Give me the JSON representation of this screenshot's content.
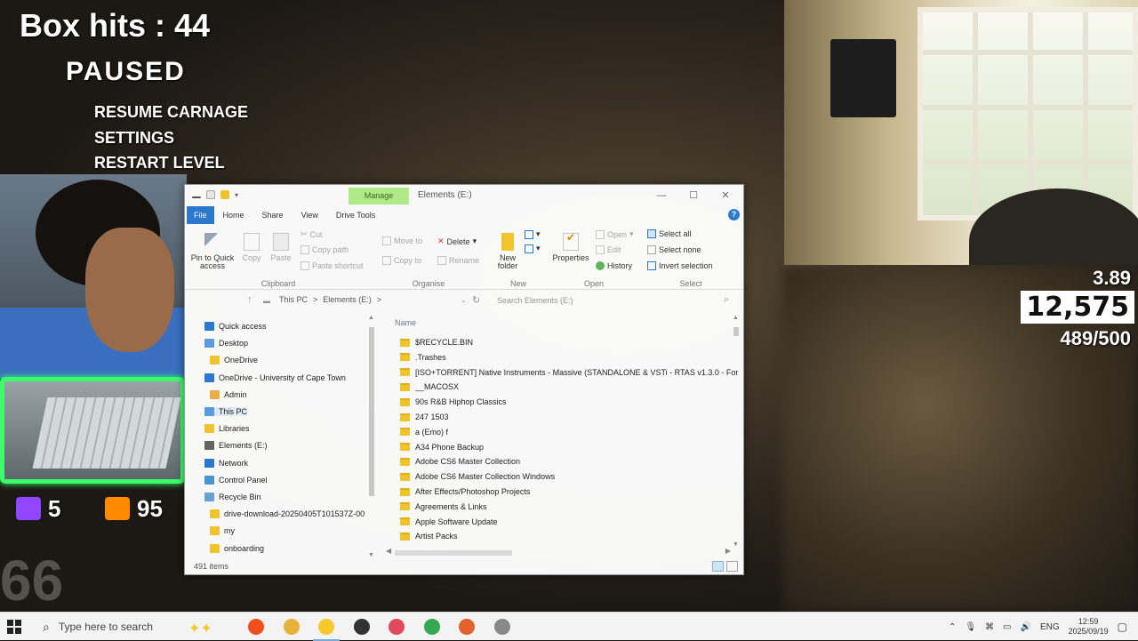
{
  "hud": {
    "box_hits": "Box hits : 44",
    "paused": "PAUSED",
    "menu": [
      "RESUME CARNAGE",
      "SETTINGS",
      "RESTART LEVEL"
    ],
    "multiplier": "3.89",
    "score": "12,575",
    "progress": "489/500",
    "twitch_count": "5",
    "youtube_count": "95",
    "faded_number": "66"
  },
  "explorer": {
    "manage_tab": "Manage",
    "title": "Elements (E:)",
    "controls": {
      "minimize": "—",
      "maximize": "☐",
      "close": "✕"
    },
    "ribbon_tabs": [
      "File",
      "Home",
      "Share",
      "View",
      "Drive Tools"
    ],
    "help": "?",
    "clipboard": {
      "label": "Clipboard",
      "pin": "Pin to Quick access",
      "copy": "Copy",
      "paste": "Paste",
      "cut": "Cut",
      "copy_path": "Copy path",
      "paste_shortcut": "Paste shortcut"
    },
    "organise": {
      "label": "Organise",
      "move_to": "Move to",
      "copy_to": "Copy to",
      "delete": "Delete",
      "rename": "Rename"
    },
    "new": {
      "label": "New",
      "new_folder": "New folder"
    },
    "open": {
      "label": "Open",
      "properties": "Properties",
      "open": "Open",
      "edit": "Edit",
      "history": "History"
    },
    "select": {
      "label": "Select",
      "select_all": "Select all",
      "select_none": "Select none",
      "invert": "Invert selection"
    },
    "address": {
      "path": [
        "This PC",
        ">",
        "Elements (E:)",
        ">"
      ],
      "search_placeholder": "Search Elements (E:)"
    },
    "nav": [
      {
        "label": "Quick access",
        "color": "#2b7cd3"
      },
      {
        "label": "Desktop",
        "color": "#5aa0e6"
      },
      {
        "label": "OneDrive",
        "color": "#f5c92c"
      },
      {
        "label": "OneDrive - University of Cape Town",
        "color": "#2b7cd3"
      },
      {
        "label": "Admin",
        "color": "#f0b34a"
      },
      {
        "label": "This PC",
        "color": "#5aa0e6"
      },
      {
        "label": "Libraries",
        "color": "#f5c92c"
      },
      {
        "label": "Elements (E:)",
        "color": "#666666"
      },
      {
        "label": "Network",
        "color": "#2b7cd3"
      },
      {
        "label": "Control Panel",
        "color": "#4a9ad8"
      },
      {
        "label": "Recycle Bin",
        "color": "#6aa6d8"
      },
      {
        "label": "drive-download-20250405T101537Z-00",
        "color": "#f5c92c"
      },
      {
        "label": "my",
        "color": "#f5c92c"
      },
      {
        "label": "onboarding",
        "color": "#f5c92c"
      }
    ],
    "column_name": "Name",
    "files": [
      "$RECYCLE.BIN",
      ".Trashes",
      "[ISO+TORRENT] Native Instruments - Massive (STANDALONE & VSTi - RTAS v1.3.0 - For",
      "__MACOSX",
      "90s R&B Hiphop Classics",
      "247 1503",
      "a (Emo) f",
      "A34 Phone Backup",
      "Adobe CS6 Master Collection",
      "Adobe CS6 Master Collection Windows",
      "After Effects/Photoshop Projects",
      "Agreements & Links",
      "Apple Software Update",
      "Artist Packs"
    ],
    "status": "491 items"
  },
  "taskbar": {
    "search_placeholder": "Type here to search",
    "apps": [
      {
        "name": "figma",
        "color": "#f24e1e"
      },
      {
        "name": "chrome",
        "color": "#e8b33a"
      },
      {
        "name": "file-explorer",
        "color": "#f5c92c"
      },
      {
        "name": "obs",
        "color": "#333333"
      },
      {
        "name": "snipping",
        "color": "#e04a5a"
      },
      {
        "name": "chrome-2",
        "color": "#34a853"
      },
      {
        "name": "office",
        "color": "#e3622b"
      },
      {
        "name": "app-gray",
        "color": "#888888"
      }
    ],
    "language": "ENG",
    "time": "12:59",
    "date": "2025/09/19"
  }
}
